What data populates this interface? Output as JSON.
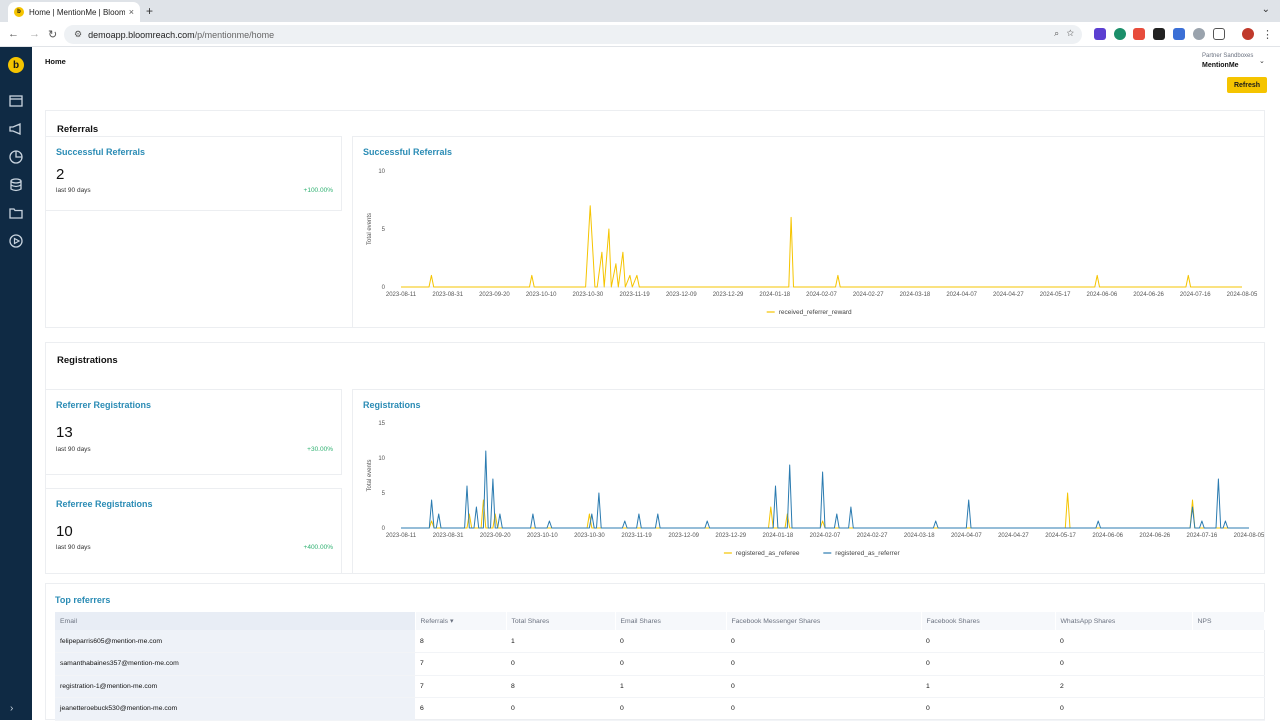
{
  "browser": {
    "tab_title": "Home | MentionMe | Bloomre...",
    "tab_close": "×",
    "new_tab": "+",
    "url_host": "demoapp.bloomreach.com",
    "url_path": "/p/mentionme/home"
  },
  "header": {
    "breadcrumb": "Home",
    "sandbox_label": "Partner Sandboxes",
    "sandbox_name": "MentionMe",
    "refresh_label": "Refresh"
  },
  "referrals": {
    "section_title": "Referrals",
    "kpi": {
      "title": "Successful Referrals",
      "value": "2",
      "period": "last 90 days",
      "delta": "+100.00%"
    },
    "chart_title": "Successful Referrals"
  },
  "registrations": {
    "section_title": "Registrations",
    "referrer_kpi": {
      "title": "Referrer Registrations",
      "value": "13",
      "period": "last 90 days",
      "delta": "+30.00%"
    },
    "referee_kpi": {
      "title": "Referree Registrations",
      "value": "10",
      "period": "last 90 days",
      "delta": "+400.00%"
    },
    "chart_title": "Registrations"
  },
  "top_referrers": {
    "title": "Top referrers",
    "columns": [
      "Email",
      "Referrals",
      "Total Shares",
      "Email Shares",
      "Facebook Messenger Shares",
      "Facebook Shares",
      "WhatsApp Shares",
      "NPS"
    ],
    "sort_indicator": "▾",
    "rows": [
      [
        "felipeparris605@mention-me.com",
        "8",
        "1",
        "0",
        "0",
        "0",
        "0",
        ""
      ],
      [
        "samanthabaines357@mention-me.com",
        "7",
        "0",
        "0",
        "0",
        "0",
        "0",
        ""
      ],
      [
        "registration-1@mention-me.com",
        "7",
        "8",
        "1",
        "0",
        "1",
        "2",
        ""
      ],
      [
        "jeanetteroebuck530@mention-me.com",
        "6",
        "0",
        "0",
        "0",
        "0",
        "0",
        ""
      ]
    ]
  },
  "chart_data": [
    {
      "type": "line",
      "title": "Successful Referrals",
      "xlabel": "",
      "ylabel": "Total events",
      "ylim": [
        0,
        10
      ],
      "yticks": [
        "0",
        "5",
        "10"
      ],
      "x_tick_labels": [
        "2023-08-11",
        "2023-08-31",
        "2023-09-20",
        "2023-10-10",
        "2023-10-30",
        "2023-11-19",
        "2023-12-09",
        "2023-12-29",
        "2024-01-18",
        "2024-02-07",
        "2024-02-27",
        "2024-03-18",
        "2024-04-07",
        "2024-04-27",
        "2024-05-17",
        "2024-06-06",
        "2024-06-26",
        "2024-07-16",
        "2024-08-05"
      ],
      "x_range_days": [
        0,
        360
      ],
      "legend_position": "bottom",
      "series": [
        {
          "name": "received_referrer_reward",
          "color": "#f5c400",
          "points": [
            [
              0,
              0
            ],
            [
              12,
              0
            ],
            [
              13,
              1
            ],
            [
              14,
              0
            ],
            [
              55,
              0
            ],
            [
              56,
              1
            ],
            [
              57,
              0
            ],
            [
              79,
              0
            ],
            [
              81,
              7
            ],
            [
              83,
              0
            ],
            [
              84,
              0
            ],
            [
              86,
              3
            ],
            [
              87,
              0
            ],
            [
              89,
              5
            ],
            [
              90,
              0
            ],
            [
              92,
              2
            ],
            [
              93,
              0
            ],
            [
              95,
              3
            ],
            [
              96,
              0
            ],
            [
              98,
              1
            ],
            [
              99,
              0
            ],
            [
              101,
              1
            ],
            [
              102,
              0
            ],
            [
              166,
              0
            ],
            [
              167,
              6
            ],
            [
              168,
              0
            ],
            [
              186,
              0
            ],
            [
              187,
              1
            ],
            [
              188,
              0
            ],
            [
              297,
              0
            ],
            [
              298,
              1
            ],
            [
              299,
              0
            ],
            [
              336,
              0
            ],
            [
              337,
              1
            ],
            [
              338,
              0
            ],
            [
              360,
              0
            ]
          ]
        }
      ]
    },
    {
      "type": "line",
      "title": "Registrations",
      "xlabel": "",
      "ylabel": "Total events",
      "ylim": [
        0,
        15
      ],
      "yticks": [
        "0",
        "5",
        "10",
        "15"
      ],
      "x_tick_labels": [
        "2023-08-11",
        "2023-08-31",
        "2023-09-20",
        "2023-10-10",
        "2023-10-30",
        "2023-11-19",
        "2023-12-09",
        "2023-12-29",
        "2024-01-18",
        "2024-02-07",
        "2024-02-27",
        "2024-03-18",
        "2024-04-07",
        "2024-04-27",
        "2024-05-17",
        "2024-06-06",
        "2024-06-26",
        "2024-07-16",
        "2024-08-05"
      ],
      "x_range_days": [
        0,
        360
      ],
      "legend_position": "bottom",
      "series": [
        {
          "name": "registered_as_referee",
          "color": "#f5c400",
          "points": [
            [
              0,
              0
            ],
            [
              12,
              0
            ],
            [
              13,
              1
            ],
            [
              14,
              0
            ],
            [
              28,
              0
            ],
            [
              29,
              2
            ],
            [
              30,
              0
            ],
            [
              34,
              0
            ],
            [
              35,
              4
            ],
            [
              36,
              0
            ],
            [
              39,
              0
            ],
            [
              40,
              2
            ],
            [
              41,
              0
            ],
            [
              79,
              0
            ],
            [
              80,
              2
            ],
            [
              81,
              0
            ],
            [
              156,
              0
            ],
            [
              157,
              3
            ],
            [
              158,
              0
            ],
            [
              163,
              0
            ],
            [
              164,
              2
            ],
            [
              165,
              0
            ],
            [
              178,
              0
            ],
            [
              179,
              1
            ],
            [
              180,
              0
            ],
            [
              282,
              0
            ],
            [
              283,
              5
            ],
            [
              284,
              0
            ],
            [
              335,
              0
            ],
            [
              336,
              4
            ],
            [
              337,
              0
            ],
            [
              360,
              0
            ]
          ]
        },
        {
          "name": "registered_as_referrer",
          "color": "#2b7bb0",
          "points": [
            [
              0,
              0
            ],
            [
              12,
              0
            ],
            [
              13,
              4
            ],
            [
              14,
              0
            ],
            [
              15,
              0
            ],
            [
              16,
              2
            ],
            [
              17,
              0
            ],
            [
              27,
              0
            ],
            [
              28,
              6
            ],
            [
              29,
              0
            ],
            [
              31,
              0
            ],
            [
              32,
              3
            ],
            [
              33,
              0
            ],
            [
              35,
              0
            ],
            [
              36,
              11
            ],
            [
              37,
              0
            ],
            [
              38,
              0
            ],
            [
              39,
              7
            ],
            [
              40,
              0
            ],
            [
              41,
              0
            ],
            [
              42,
              2
            ],
            [
              43,
              0
            ],
            [
              55,
              0
            ],
            [
              56,
              2
            ],
            [
              57,
              0
            ],
            [
              62,
              0
            ],
            [
              63,
              1
            ],
            [
              64,
              0
            ],
            [
              80,
              0
            ],
            [
              81,
              2
            ],
            [
              82,
              0
            ],
            [
              83,
              0
            ],
            [
              84,
              5
            ],
            [
              85,
              0
            ],
            [
              94,
              0
            ],
            [
              95,
              1
            ],
            [
              96,
              0
            ],
            [
              100,
              0
            ],
            [
              101,
              2
            ],
            [
              102,
              0
            ],
            [
              108,
              0
            ],
            [
              109,
              2
            ],
            [
              110,
              0
            ],
            [
              129,
              0
            ],
            [
              130,
              1
            ],
            [
              131,
              0
            ],
            [
              158,
              0
            ],
            [
              159,
              6
            ],
            [
              160,
              0
            ],
            [
              164,
              0
            ],
            [
              165,
              9
            ],
            [
              166,
              0
            ],
            [
              178,
              0
            ],
            [
              179,
              8
            ],
            [
              180,
              0
            ],
            [
              184,
              0
            ],
            [
              185,
              2
            ],
            [
              186,
              0
            ],
            [
              190,
              0
            ],
            [
              191,
              3
            ],
            [
              192,
              0
            ],
            [
              226,
              0
            ],
            [
              227,
              1
            ],
            [
              228,
              0
            ],
            [
              240,
              0
            ],
            [
              241,
              4
            ],
            [
              242,
              0
            ],
            [
              295,
              0
            ],
            [
              296,
              1
            ],
            [
              297,
              0
            ],
            [
              335,
              0
            ],
            [
              336,
              3
            ],
            [
              337,
              0
            ],
            [
              339,
              0
            ],
            [
              340,
              1
            ],
            [
              341,
              0
            ],
            [
              346,
              0
            ],
            [
              347,
              7
            ],
            [
              348,
              0
            ],
            [
              349,
              0
            ],
            [
              350,
              1
            ],
            [
              351,
              0
            ],
            [
              360,
              0
            ]
          ]
        }
      ]
    }
  ]
}
